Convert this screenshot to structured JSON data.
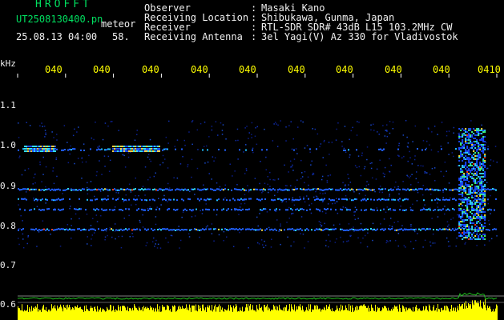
{
  "header": {
    "brand": "HROFFT",
    "filename": "UT2508130400.pn",
    "mode": "meteor",
    "datetime": "25.08.13 04:00",
    "count": "58."
  },
  "station_info": [
    {
      "label": "Observer",
      "value": "Masaki Kano"
    },
    {
      "label": "Receiving Location",
      "value": "Shibukawa, Gunma, Japan"
    },
    {
      "label": "Receiver",
      "value": "RTL-SDR SDR# 43dB L15 103.2MHz CW"
    },
    {
      "label": "Receiving Antenna",
      "value": "3el Yagi(V) Az 330 for Vladivostok"
    }
  ],
  "colon": ":",
  "axes": {
    "y_unit": "kHz",
    "y_ticks": [
      "1.1",
      "1.0",
      "0.9",
      "0.8",
      "0.7",
      "0.6"
    ],
    "x_ticks": [
      "040",
      "040",
      "040",
      "040",
      "040",
      "040",
      "040",
      "040",
      "040",
      "0410"
    ]
  },
  "spectrogram": {
    "background": "#000000",
    "trace_color": "#20c020",
    "level_color": "#ffff00",
    "signal_bands_khz": [
      0.99,
      0.89,
      0.865,
      0.84,
      0.79
    ],
    "burst_minutes": [
      9.2,
      9.5
    ]
  }
}
